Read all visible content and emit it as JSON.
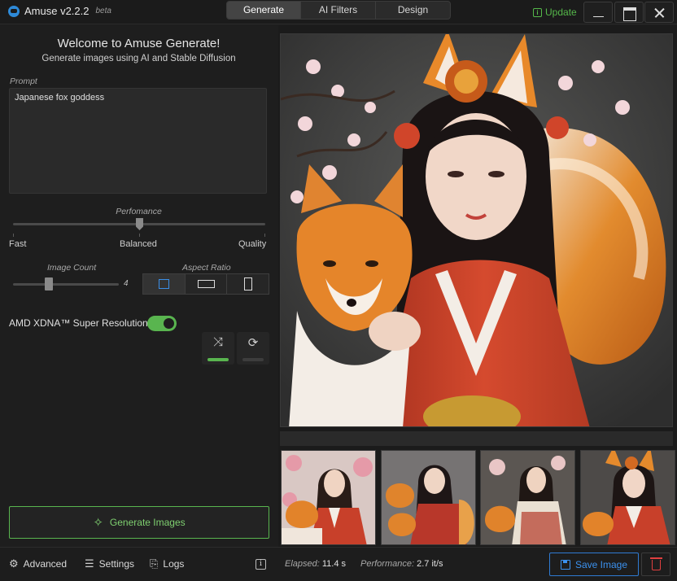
{
  "app": {
    "name": "Amuse v2.2.2",
    "beta": "beta"
  },
  "titlebar": {
    "tabs": [
      {
        "label": "Generate",
        "active": true
      },
      {
        "label": "AI Filters",
        "active": false
      },
      {
        "label": "Design",
        "active": false
      }
    ],
    "update_label": "Update"
  },
  "left": {
    "welcome": "Welcome to Amuse Generate!",
    "subtitle": "Generate images using AI and Stable Diffusion",
    "prompt_label": "Prompt",
    "prompt_value": "Japanese fox goddess",
    "performance": {
      "label": "Perfomance",
      "stops": [
        "Fast",
        "Balanced",
        "Quality"
      ],
      "selected": "Balanced",
      "level": 0.5
    },
    "image_count": {
      "label": "Image Count",
      "value": "4",
      "level": 0.3
    },
    "aspect_ratio": {
      "label": "Aspect Ratio",
      "options": [
        "square",
        "landscape",
        "portrait"
      ],
      "selected": "square"
    },
    "super_resolution": {
      "label": "AMD XDNA™ Super Resolution",
      "enabled": true
    },
    "random_seed_active": true,
    "reuse_seed_active": false,
    "generate_label": "Generate Images"
  },
  "bottom": {
    "advanced_label": "Advanced",
    "settings_label": "Settings",
    "logs_label": "Logs",
    "elapsed_label": "Elapsed:",
    "elapsed_value": "11.4 s",
    "performance_label": "Performance:",
    "performance_value": "2.7 it/s",
    "save_label": "Save Image"
  },
  "icons": {
    "advanced": "advanced-icon",
    "settings": "sliders-icon",
    "logs": "logs-icon",
    "info": "info-icon",
    "save": "save-icon",
    "delete": "trash-icon",
    "shuffle": "shuffle-icon",
    "refresh": "refresh-icon",
    "generate": "magic-wand-icon"
  },
  "colors": {
    "accent_green": "#59b54f",
    "accent_blue": "#2f7bd3",
    "danger": "#e04040"
  }
}
